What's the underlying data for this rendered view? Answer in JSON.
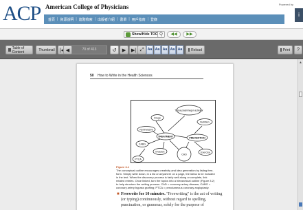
{
  "header": {
    "logo": "ACP",
    "org_name": "American College of Physicians",
    "powered_by": "Powered by",
    "nav_links": [
      "首頁",
      "資源說明",
      "進階檢索",
      "出版者介紹",
      "書單",
      "用戶指南",
      "登錄"
    ]
  },
  "tocbar": {
    "toggle_label": "Show/Hide TOC",
    "search_label": "Q",
    "prev_label": "◀◀",
    "next_label": "▶▶"
  },
  "toolbar": {
    "toc_label": "Table of Content",
    "thumbnail_label": "Thumbnail",
    "first_label": "|◀",
    "prev_label": "◀",
    "page_indicator": "70 of 413",
    "scroll_label": "↺",
    "next_label": "▶",
    "last_label": "▶|",
    "fit_label": "⤢",
    "font_sizes": [
      "Aa",
      "Aa",
      "Aa",
      "Aa",
      "Aa"
    ],
    "reload_label": "Reload",
    "print_label": "Print",
    "help_label": "?"
  },
  "page": {
    "page_number": "50",
    "running_title": "How to Write in the Health Sciences",
    "figure_label": "Figure 3-1",
    "caption_lines": [
      "The conceptual outline encourages creativity and idea generation by listing free-",
      "form. Simply write down, in a list or anywhere on a page, the ideas to be included",
      "in the text. When the discovery process is fairly well along or complete, link",
      "related entries. Once linked, turn the topics into a hierarchical outline (Figure 3.2)",
      "to help structure the writing process. CAD = coronary artery disease; CABG =",
      "coronary artery bypass grafting; PTCA = percutaneous coronary angioplasty."
    ],
    "bullet_heading": "Freewrite for 10 minutes.",
    "bullet_text": "\"Freewriting\" is the act of writing (or typing) continuously, without regard to spelling, punctuation, or grammar, solely for the purpose of"
  },
  "diagram": {
    "nodes": {
      "treatment": "TREATMENT",
      "drugs": "Drugs",
      "tpa": "Tissue plasminogen activator",
      "nutrition": "Nutrition",
      "noninvasive": "Noninvasive",
      "prevention": "PREVENTION",
      "cabg": "CABG",
      "invasive": "Invasive",
      "cad": "CAD",
      "exercise": "Exercise",
      "ptca": "PTCA"
    }
  },
  "colors": {
    "brand": "#1e4f86",
    "navbar": "#5b8fb9",
    "toolbar": "#6a6a6a",
    "figure_accent": "#c25a2a"
  }
}
